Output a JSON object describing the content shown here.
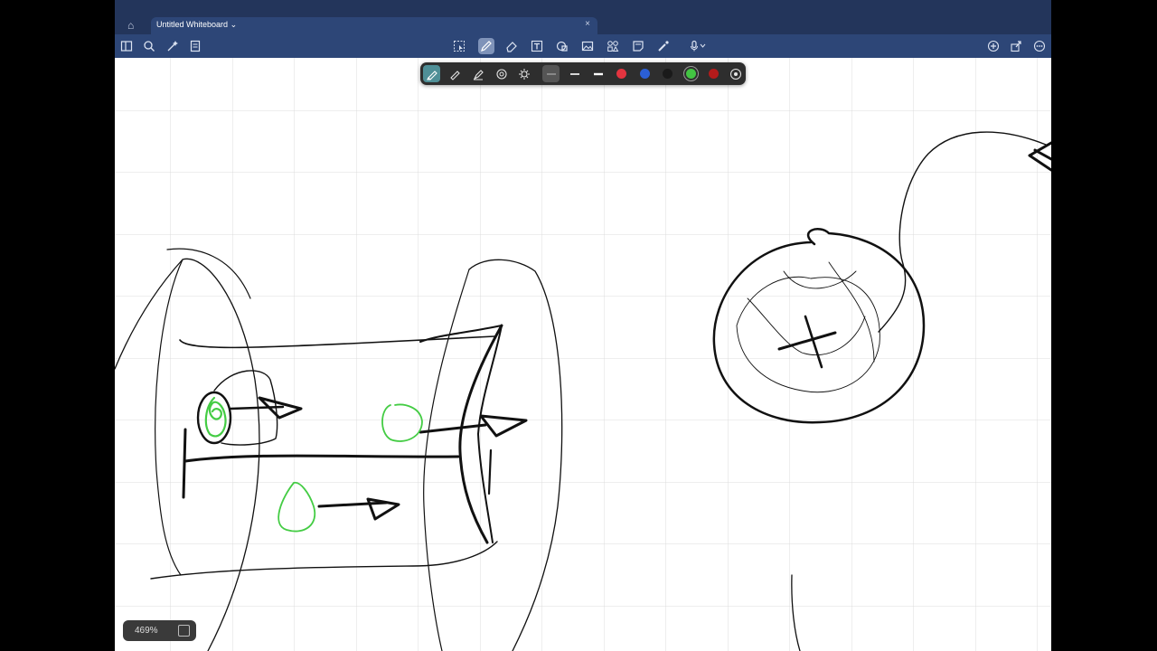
{
  "window": {
    "tab_title": "Untitled Whiteboard",
    "tab_chevron": "⌄",
    "tab_close": "×"
  },
  "toolbar_left": [
    "sidebar-icon",
    "search-icon",
    "magic-wand-icon",
    "notes-icon"
  ],
  "toolbar_center": [
    "lasso-select-icon",
    "pen-icon",
    "eraser-icon",
    "text-box-icon",
    "shapes-icon",
    "image-icon",
    "elements-icon",
    "sticky-note-icon",
    "laser-pointer-icon",
    "audio-icon"
  ],
  "toolbar_right": [
    "add-icon",
    "share-icon",
    "more-icon"
  ],
  "pen_bar": {
    "tools": [
      "fountain-pen-icon",
      "ballpoint-pen-icon",
      "highlighter-icon",
      "shape-pen-icon",
      "settings-icon"
    ],
    "colors": [
      "#e3343f",
      "#2b5fd6",
      "#1a1a1a",
      "#43c443",
      "#b31b1b"
    ]
  },
  "zoom": {
    "value": "469%"
  }
}
